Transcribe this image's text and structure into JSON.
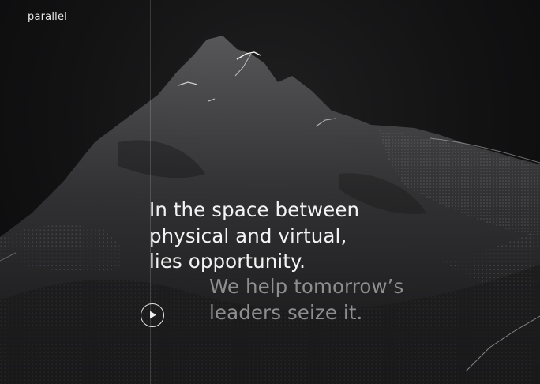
{
  "brand": {
    "name": "parallel"
  },
  "hero": {
    "headline_lines": [
      "In the space between",
      "physical and virtual,",
      "lies opportunity."
    ],
    "subline_lines": [
      "We help tomorrow’s",
      "leaders seize it."
    ]
  },
  "play_button": {
    "icon": "play-icon"
  },
  "colors": {
    "background": "#0d0d0e",
    "headline": "#f3f3f3",
    "subline": "#8e8e8e",
    "guide_line": "#ffffff"
  }
}
